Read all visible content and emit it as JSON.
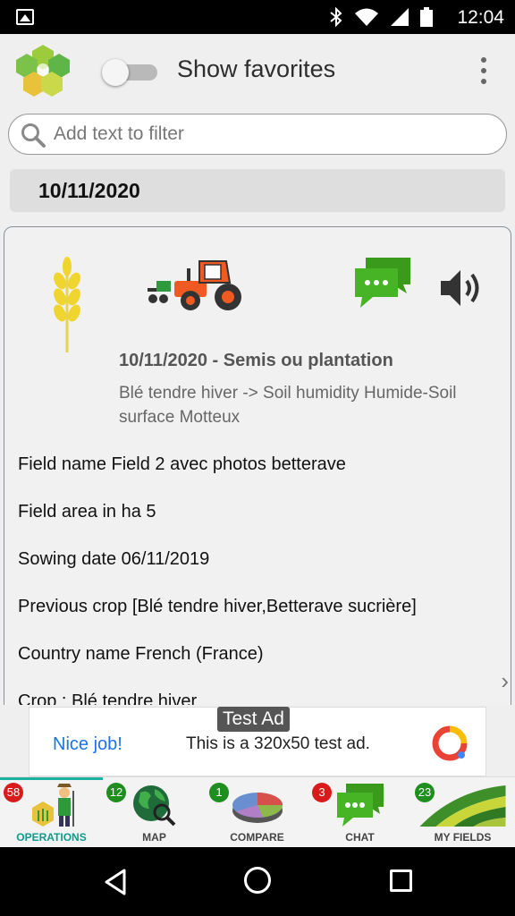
{
  "status_bar": {
    "time": "12:04"
  },
  "app_bar": {
    "title": "Show favorites",
    "favorites_enabled": false
  },
  "search": {
    "placeholder": "Add text to filter",
    "value": ""
  },
  "date_header": "10/11/2020",
  "operation": {
    "title": "10/11/2020 - Semis ou plantation",
    "description": "Blé tendre hiver  -> Soil humidity Humide-Soil surface Motteux",
    "fields": [
      "Field name Field 2 avec photos betterave",
      "Field area in ha 5",
      "Sowing date 06/11/2019",
      "Previous crop [Blé tendre hiver,Betterave sucrière]",
      "Country name French (France)",
      "Crop : Blé tendre hiver"
    ]
  },
  "ad": {
    "tag": "Test Ad",
    "headline": "Nice job!",
    "text": "This is a 320x50 test ad."
  },
  "bottom_nav": [
    {
      "label": "OPERATIONS",
      "badge": "58",
      "badge_color": "#d81b1b",
      "active": true
    },
    {
      "label": "MAP",
      "badge": "12",
      "badge_color": "#1e8e1e"
    },
    {
      "label": "COMPARE",
      "badge": "1",
      "badge_color": "#1e8e1e"
    },
    {
      "label": "CHAT",
      "badge": "3",
      "badge_color": "#d81b1b"
    },
    {
      "label": "MY FIELDS",
      "badge": "23",
      "badge_color": "#1e8e1e"
    }
  ],
  "colors": {
    "accent": "#0b9c8c",
    "chat_green": "#3a9a1c",
    "tractor_orange": "#ef5a22"
  }
}
